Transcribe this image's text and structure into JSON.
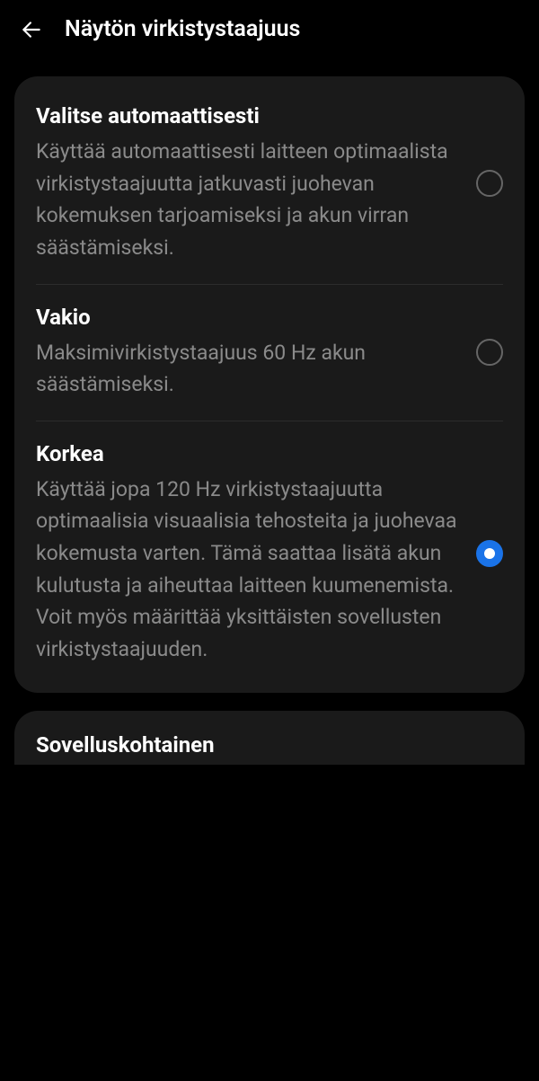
{
  "header": {
    "title": "Näytön virkistystaajuus"
  },
  "options": [
    {
      "title": "Valitse automaattisesti",
      "description": "Käyttää automaattisesti laitteen optimaalista virkistystaajuutta jatkuvasti juohevan kokemuksen tarjoamiseksi ja akun virran säästämiseksi.",
      "selected": false
    },
    {
      "title": "Vakio",
      "description": "Maksimivirkistystaajuus 60 Hz akun säästämiseksi.",
      "selected": false
    },
    {
      "title": "Korkea",
      "description": "Käyttää jopa 120 Hz virkistystaajuutta optimaalisia visuaalisia tehosteita ja juohevaa kokemusta varten. Tämä saattaa lisätä akun kulutusta ja aiheuttaa laitteen kuumenemista. Voit myös määrittää yksittäisten sovellusten virkistystaajuuden.",
      "selected": true
    }
  ],
  "secondary": {
    "title": "Sovelluskohtainen"
  }
}
